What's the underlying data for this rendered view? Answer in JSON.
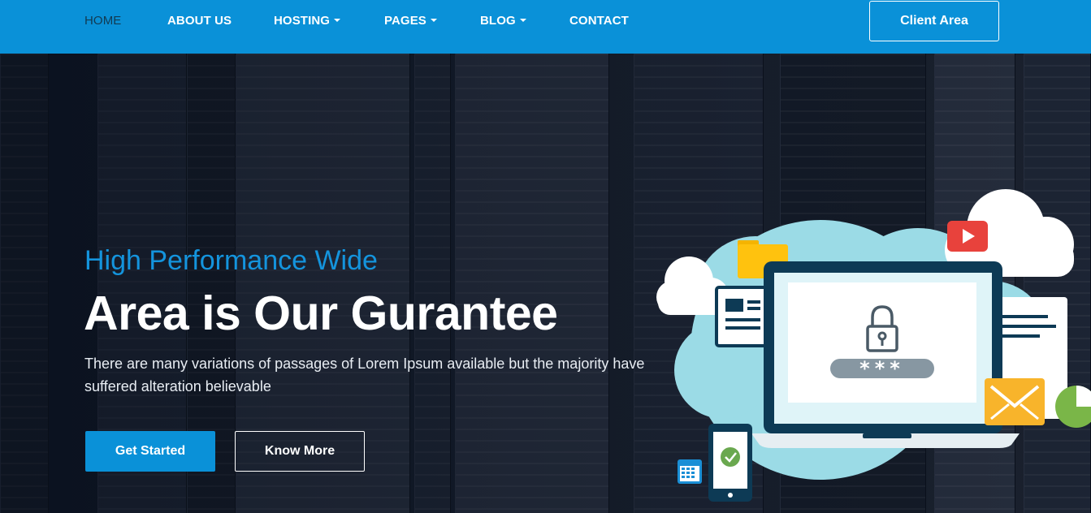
{
  "nav": {
    "items": [
      {
        "label": "HOME"
      },
      {
        "label": "ABOUT US"
      },
      {
        "label": "HOSTING"
      },
      {
        "label": "PAGES"
      },
      {
        "label": "BLOG"
      },
      {
        "label": "CONTACT"
      }
    ],
    "client_area": "Client Area"
  },
  "hero": {
    "subtitle": "High Performance Wide",
    "headline": "Area is Our Gurantee",
    "description": "There are many variations of passages of Lorem Ipsum available but the majority have suffered alteration believable",
    "primary_button": "Get Started",
    "secondary_button": "Know More",
    "password_mask": "***"
  },
  "colors": {
    "brand_blue": "#0a91d8",
    "hero_bg": "#141d2c",
    "cloud_teal": "#9bdbe6"
  },
  "icons": [
    "caret-down-icon",
    "cloud-icon",
    "folder-icon",
    "video-play-icon",
    "laptop-icon",
    "lock-icon",
    "document-icon",
    "mobile-check-icon",
    "calendar-icon",
    "email-icon",
    "pie-chart-icon"
  ]
}
